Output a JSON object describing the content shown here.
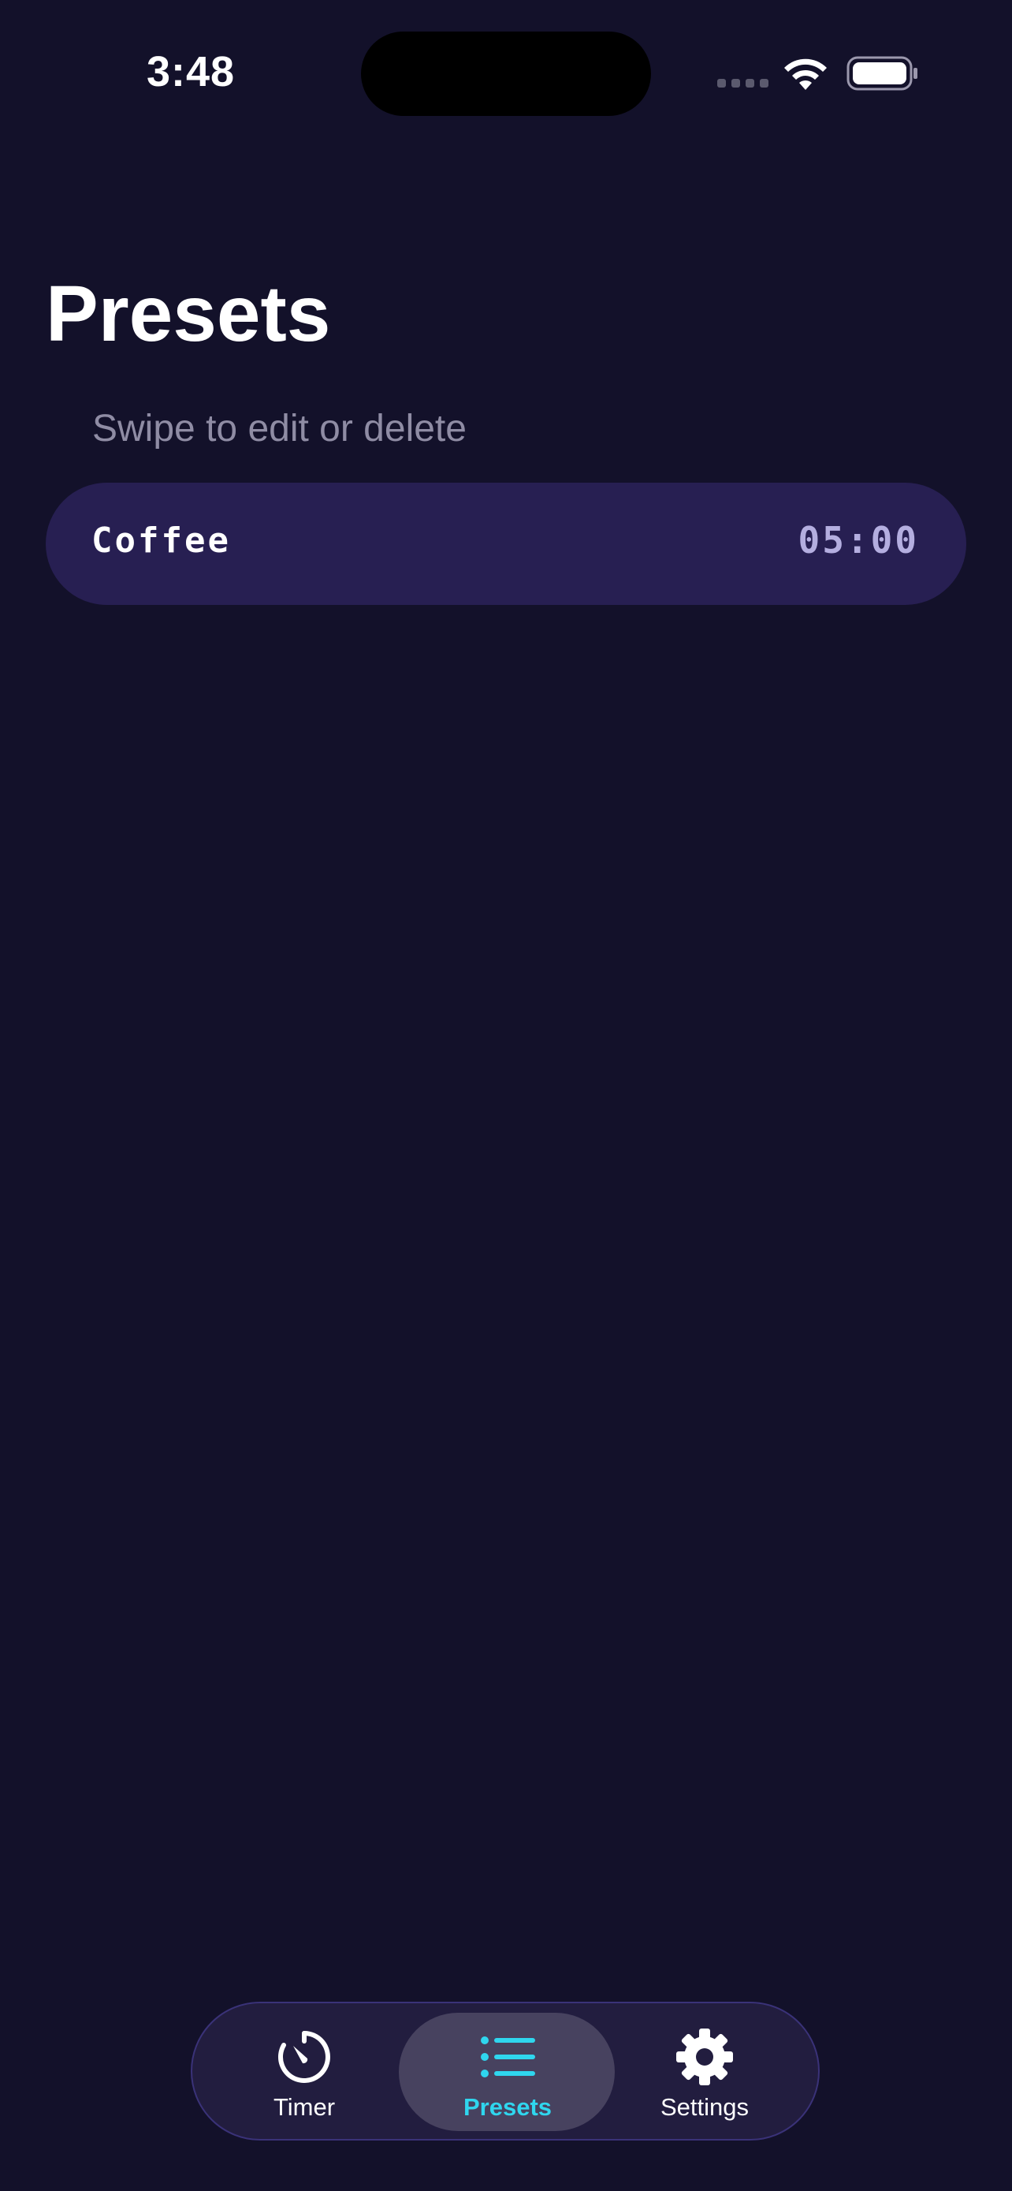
{
  "status_bar": {
    "time": "3:48"
  },
  "header": {
    "title": "Presets",
    "hint": "Swipe to edit or delete"
  },
  "presets": [
    {
      "name": "Coffee",
      "duration": "05:00"
    }
  ],
  "tab_bar": {
    "tabs": [
      {
        "label": "Timer",
        "icon": "timer-icon",
        "active": false
      },
      {
        "label": "Presets",
        "icon": "list-icon",
        "active": true
      },
      {
        "label": "Settings",
        "icon": "gear-icon",
        "active": false
      }
    ]
  },
  "colors": {
    "background": "#13112a",
    "row_background": "#271f52",
    "accent": "#2fd6ee",
    "hint_text": "#8f8ca4",
    "duration_text": "#b4aee0"
  }
}
